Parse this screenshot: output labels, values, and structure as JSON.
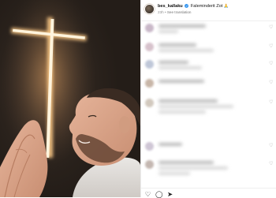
{
  "post": {
    "username": "bes_kallaku",
    "verified_mark": "✓",
    "caption": "Faleminderit Zot",
    "caption_emoji": "🙏",
    "time_ago": "23h",
    "separator": "•",
    "see_translation": "See translation"
  },
  "comments": [
    {
      "avatar_color": "#c9b8c8",
      "widths": [
        60,
        25
      ],
      "liked": true
    },
    {
      "avatar_color": "#d7c2cc",
      "widths": [
        48,
        70
      ],
      "liked": true
    },
    {
      "avatar_color": "#bfc7d8",
      "widths": [
        38,
        55
      ],
      "liked": true
    },
    {
      "avatar_color": "#c8b6a8",
      "widths": [
        58
      ],
      "liked": true
    },
    {
      "avatar_color": "#d2c9be",
      "widths": [
        75,
        95,
        60
      ],
      "liked": true
    },
    {
      "avatar_color": "#cfc6d5",
      "widths": [
        30
      ],
      "liked": true
    },
    {
      "avatar_color": "#c4b7b1",
      "widths": [
        70,
        88,
        40
      ],
      "liked": true
    }
  ],
  "actions": {
    "like_icon": "heart-outline-icon",
    "comment_icon": "comment-icon",
    "share_icon": "share-icon",
    "save_icon": "bookmark-icon"
  },
  "colors": {
    "verified": "#3897f0",
    "cross_glow": "#ffd9a0",
    "wall": "#3b2e25"
  }
}
